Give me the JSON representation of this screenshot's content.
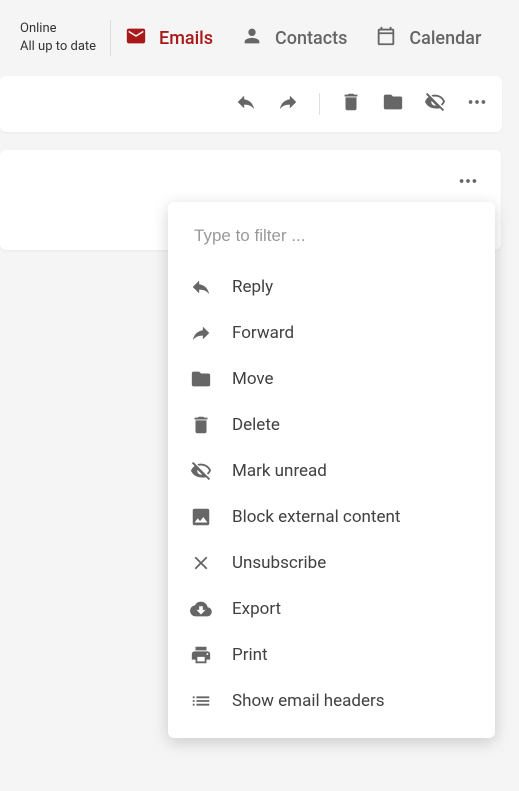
{
  "status": {
    "line1": "Online",
    "line2": "All up to date"
  },
  "nav": {
    "emails": "Emails",
    "contacts": "Contacts",
    "calendar": "Calendar"
  },
  "dropdown": {
    "filter_placeholder": "Type to filter ...",
    "items": {
      "reply": "Reply",
      "forward": "Forward",
      "move": "Move",
      "delete": "Delete",
      "mark_unread": "Mark unread",
      "block_external": "Block external content",
      "unsubscribe": "Unsubscribe",
      "export": "Export",
      "print": "Print",
      "show_headers": "Show email headers"
    }
  }
}
